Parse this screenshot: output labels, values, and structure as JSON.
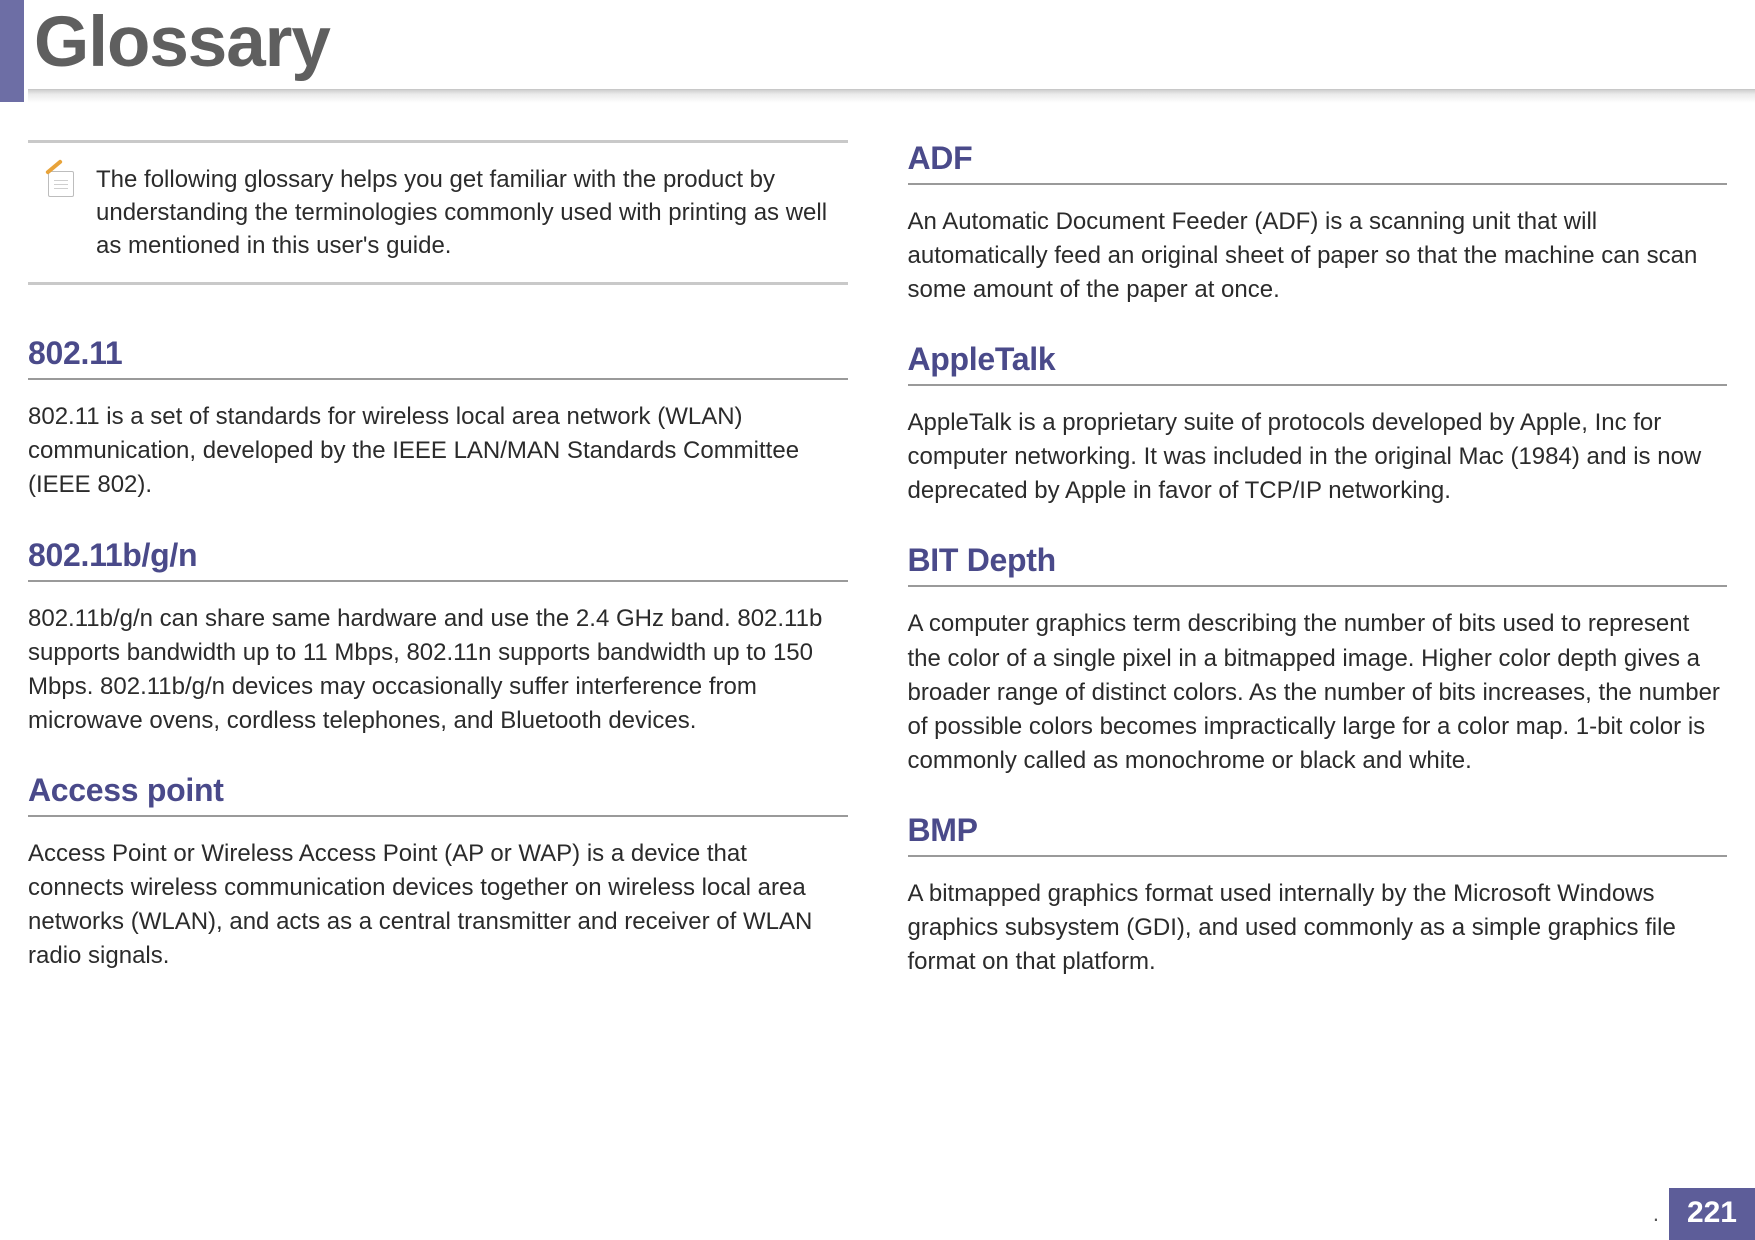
{
  "header": {
    "title": "Glossary"
  },
  "note": {
    "text": "The following glossary helps you get familiar with the product by understanding the terminologies commonly used with printing as well as mentioned in this user's guide."
  },
  "left_column": [
    {
      "term": "802.11",
      "definition": "802.11 is a set of standards for wireless local area network (WLAN) communication, developed by the IEEE LAN/MAN Standards Committee (IEEE 802)."
    },
    {
      "term": "802.11b/g/n",
      "definition": "802.11b/g/n can share same hardware and use the 2.4 GHz band. 802.11b supports bandwidth up to 11 Mbps, 802.11n supports bandwidth up to 150 Mbps. 802.11b/g/n devices may occasionally suffer interference from microwave ovens, cordless telephones, and Bluetooth devices."
    },
    {
      "term": "Access point",
      "definition": "Access Point or Wireless Access Point (AP or WAP) is a device that connects wireless communication devices together on wireless local area networks (WLAN), and acts as a central transmitter and receiver of WLAN radio signals."
    }
  ],
  "right_column": [
    {
      "term": "ADF",
      "definition": "An Automatic Document Feeder (ADF) is a scanning unit that will automatically feed an original sheet of paper so that the machine can scan some amount of the paper at once."
    },
    {
      "term": "AppleTalk",
      "definition": "AppleTalk is a proprietary suite of protocols developed by Apple, Inc for computer networking. It was included in the original Mac (1984) and is now deprecated by Apple in favor of TCP/IP networking."
    },
    {
      "term": "BIT Depth",
      "definition": "A computer graphics term describing the number of bits used to represent the color of a single pixel in a bitmapped image. Higher color depth gives a broader range of distinct colors. As the number of bits increases, the number of possible colors becomes impractically large for a color map. 1-bit color is commonly called as monochrome or black and white."
    },
    {
      "term": "BMP",
      "definition": "A bitmapped graphics format used internally by the Microsoft Windows graphics subsystem (GDI), and used commonly as a simple graphics file format on that platform."
    }
  ],
  "footer": {
    "dot": ".",
    "page": "221"
  }
}
